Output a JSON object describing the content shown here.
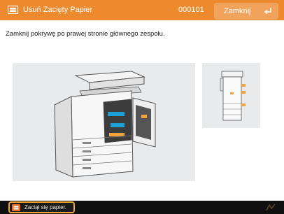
{
  "header": {
    "title": "Usuń Zacięty Papier",
    "job_id": "000101",
    "close_label": "Zamknij",
    "icon": "paper-jam-icon",
    "accent_color": "#ee8a2e"
  },
  "instruction": "Zamknij pokrywę po prawej stronie głównego zespołu.",
  "illustration": {
    "main_icon": "printer-open-door-illustration",
    "thumb_icon": "printer-jam-locations-illustration"
  },
  "status": {
    "message": "Zaciął się papier.",
    "icon": "warning-icon",
    "right_icon": "signal-icon"
  }
}
